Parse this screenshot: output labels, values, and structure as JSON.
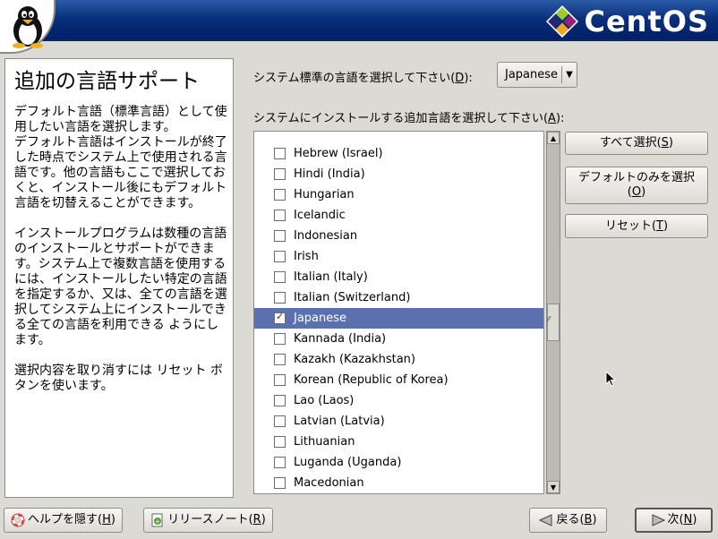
{
  "header": {
    "brand": "CentOS"
  },
  "help": {
    "title": "追加の言語サポート",
    "paragraphs": [
      "デフォルト言語（標準言語）として使用したい言語を選択します。\nデフォルト言語はインストールが終了した時点でシステム上で使用される言語です。他の言語もここで選択しておくと、インストール後にもデフォルト言語を切替えることができます。",
      "インストールプログラムは数種の言語のインストールとサポートができます。システム上で複数言語を使用するには、インストールしたい特定の言語を指定するか、又は、全ての言語を選択してシステム上にインストールできる全ての言語を利用できる ようにします。",
      "選択内容を取り消すには リセット ボタンを使います。"
    ]
  },
  "default_language": {
    "label_pre": "システム標準の言語を選択して下さい(",
    "label_key": "D",
    "label_post": "):",
    "value": "Japanese"
  },
  "additional": {
    "label_pre": "システムにインストールする追加言語を選択して下さい(",
    "label_key": "A",
    "label_post": "):",
    "languages": [
      {
        "name": "Hebrew (Israel)",
        "checked": false
      },
      {
        "name": "Hindi (India)",
        "checked": false
      },
      {
        "name": "Hungarian",
        "checked": false
      },
      {
        "name": "Icelandic",
        "checked": false
      },
      {
        "name": "Indonesian",
        "checked": false
      },
      {
        "name": "Irish",
        "checked": false
      },
      {
        "name": "Italian (Italy)",
        "checked": false
      },
      {
        "name": "Italian (Switzerland)",
        "checked": false
      },
      {
        "name": "Japanese",
        "checked": true,
        "selected": true
      },
      {
        "name": "Kannada (India)",
        "checked": false
      },
      {
        "name": "Kazakh (Kazakhstan)",
        "checked": false
      },
      {
        "name": "Korean (Republic of Korea)",
        "checked": false
      },
      {
        "name": "Lao (Laos)",
        "checked": false
      },
      {
        "name": "Latvian (Latvia)",
        "checked": false
      },
      {
        "name": "Lithuanian",
        "checked": false
      },
      {
        "name": "Luganda (Uganda)",
        "checked": false
      },
      {
        "name": "Macedonian",
        "checked": false
      }
    ]
  },
  "buttons": {
    "select_all": {
      "pre": "すべて選択(",
      "key": "S",
      "post": ")"
    },
    "default_only": {
      "line1": "デフォルトのみを選択",
      "pre": "(",
      "key": "O",
      "post": ")"
    },
    "reset": {
      "pre": "リセット(",
      "key": "T",
      "post": ")"
    },
    "hide_help": {
      "pre": "ヘルプを隠す(",
      "key": "H",
      "post": ")"
    },
    "release_notes": {
      "pre": "リリースノート(",
      "key": "R",
      "post": ")"
    },
    "back": {
      "pre": "戻る(",
      "key": "B",
      "post": ")"
    },
    "next": {
      "pre": "次(",
      "key": "N",
      "post": ")"
    }
  },
  "colors": {
    "header_blue": "#0a2f7a",
    "selection": "#5b70ae",
    "background": "#dcdad5"
  }
}
